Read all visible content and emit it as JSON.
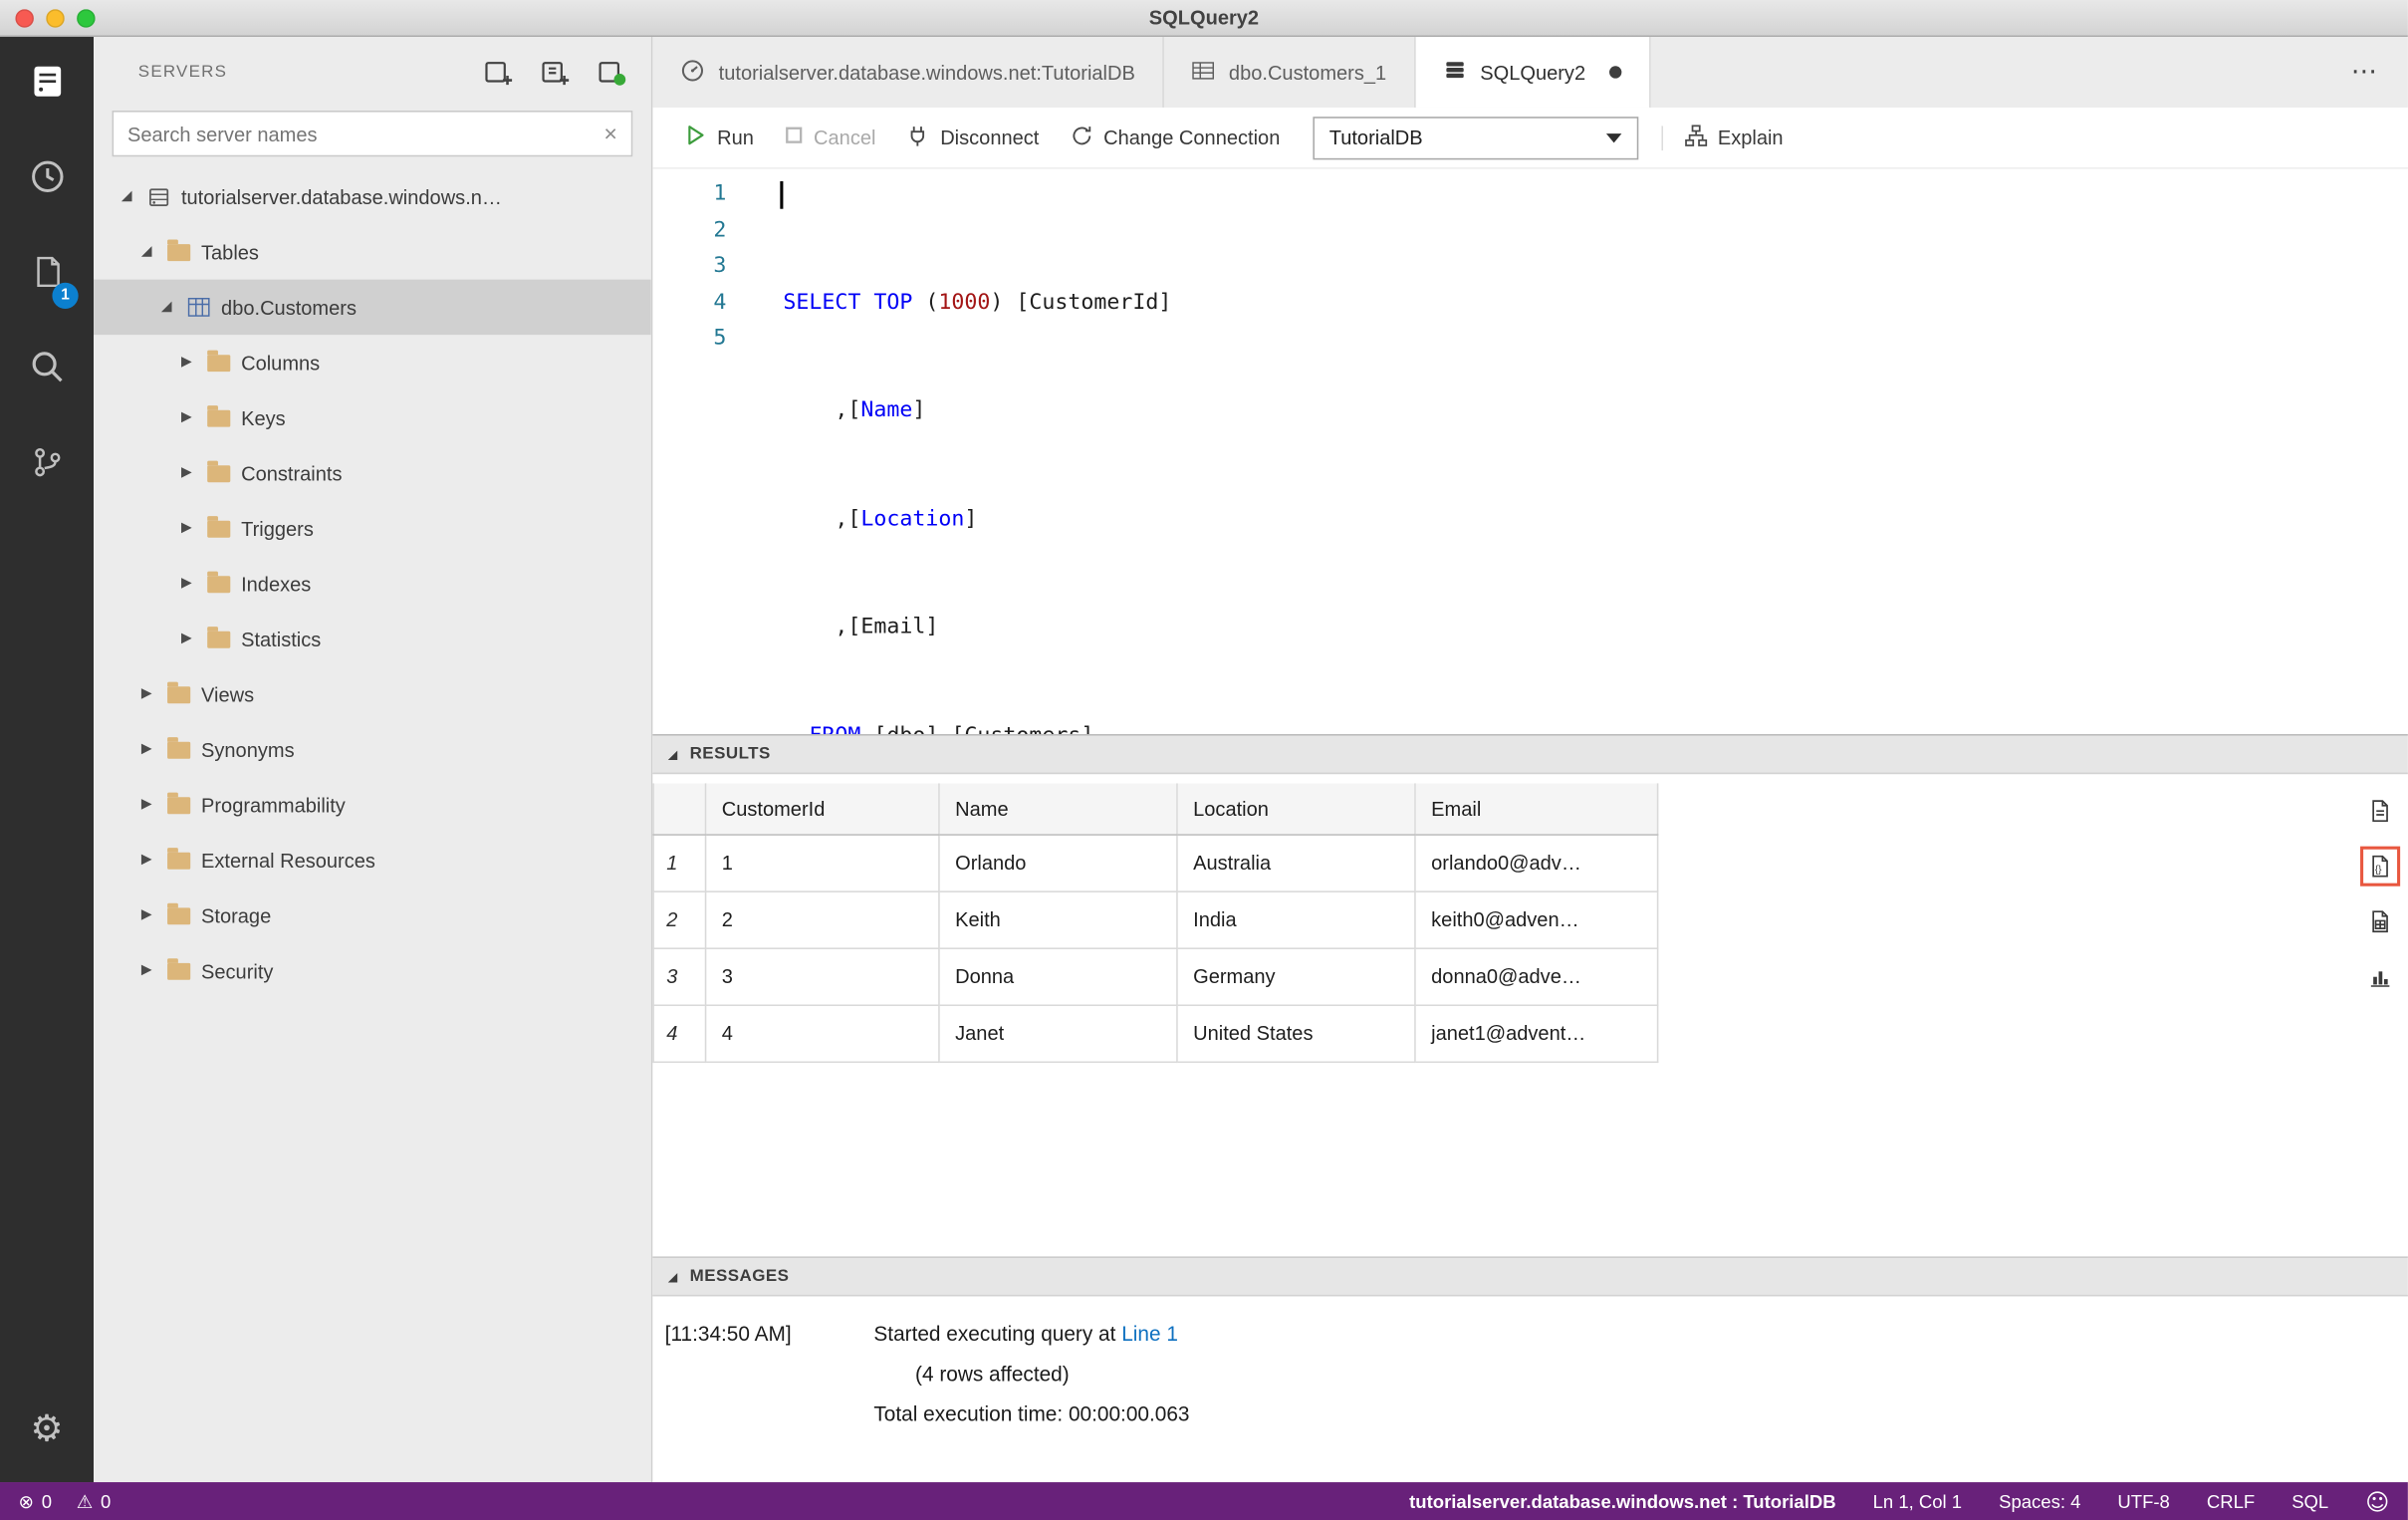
{
  "window": {
    "title": "SQLQuery2"
  },
  "icons": {
    "twisty_expanded": "◢",
    "twisty_collapsed": "▶",
    "clear": "×",
    "ellipsis": "⋯",
    "gear": "⚙",
    "error": "⊗",
    "warning": "⚠",
    "smiley": "☺"
  },
  "activity_bar": {
    "items": [
      {
        "name": "servers"
      },
      {
        "name": "task-history"
      },
      {
        "name": "open-editors",
        "badge": "1"
      },
      {
        "name": "search"
      },
      {
        "name": "source-control"
      }
    ],
    "settings": {
      "name": "settings"
    }
  },
  "sidebar": {
    "title": "SERVERS",
    "search": {
      "placeholder": "Search server names"
    },
    "tree": [
      {
        "label": "tutorialserver.database.windows.n…"
      },
      {
        "label": "Tables"
      },
      {
        "label": "dbo.Customers"
      },
      {
        "label": "Columns"
      },
      {
        "label": "Keys"
      },
      {
        "label": "Constraints"
      },
      {
        "label": "Triggers"
      },
      {
        "label": "Indexes"
      },
      {
        "label": "Statistics"
      },
      {
        "label": "Views"
      },
      {
        "label": "Synonyms"
      },
      {
        "label": "Programmability"
      },
      {
        "label": "External Resources"
      },
      {
        "label": "Storage"
      },
      {
        "label": "Security"
      }
    ]
  },
  "tabs": [
    {
      "label": "tutorialserver.database.windows.net:TutorialDB"
    },
    {
      "label": "dbo.Customers_1"
    },
    {
      "label": "SQLQuery2"
    }
  ],
  "toolbar": {
    "run": "Run",
    "cancel": "Cancel",
    "disconnect": "Disconnect",
    "change_connection": "Change Connection",
    "database": "TutorialDB",
    "explain": "Explain"
  },
  "editor": {
    "line_numbers": [
      "1",
      "2",
      "3",
      "4",
      "5"
    ],
    "lines": [
      {
        "t0": "SELECT",
        "t1": " ",
        "t2": "TOP",
        "t3": " (",
        "t4": "1000",
        "t5": ") [CustomerId]"
      },
      {
        "t0": "    ,[",
        "t1": "Name",
        "t2": "]"
      },
      {
        "t0": "    ,[",
        "t1": "Location",
        "t2": "]"
      },
      {
        "t0": "    ,[Email]"
      },
      {
        "t0": "  ",
        "t1": "FROM",
        "t2": " [dbo].[Customers]"
      }
    ]
  },
  "results": {
    "title": "RESULTS",
    "columns": [
      "CustomerId",
      "Name",
      "Location",
      "Email"
    ],
    "rows": [
      {
        "num": "1",
        "customer_id": "1",
        "name": "Orlando",
        "location": "Australia",
        "email": "orlando0@adv…"
      },
      {
        "num": "2",
        "customer_id": "2",
        "name": "Keith",
        "location": "India",
        "email": "keith0@adven…"
      },
      {
        "num": "3",
        "customer_id": "3",
        "name": "Donna",
        "location": "Germany",
        "email": "donna0@adve…"
      },
      {
        "num": "4",
        "customer_id": "4",
        "name": "Janet",
        "location": "United States",
        "email": "janet1@advent…"
      }
    ]
  },
  "messages": {
    "title": "MESSAGES",
    "timestamp": "[11:34:50 AM]",
    "line1_text": "Started executing query at ",
    "line1_link": "Line 1",
    "line2": "(4 rows affected)",
    "line3": "Total execution time: 00:00:00.063"
  },
  "status_bar": {
    "errors": "0",
    "warnings": "0",
    "connection": "tutorialserver.database.windows.net : TutorialDB",
    "cursor": "Ln 1, Col 1",
    "spaces": "Spaces: 4",
    "encoding": "UTF-8",
    "eol": "CRLF",
    "language": "SQL"
  },
  "colors": {
    "status_bar": "#68217A",
    "badge": "#0C80CF",
    "keyword": "#0000F6",
    "number": "#A31515",
    "highlight_border": "#E8573F"
  }
}
